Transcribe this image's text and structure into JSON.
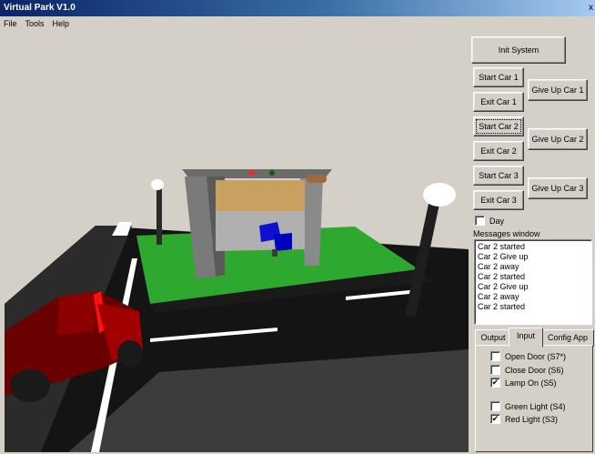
{
  "window": {
    "title": "Virtual Park V1.0",
    "close_label": "x"
  },
  "menu": [
    "File",
    "Tools",
    "Help"
  ],
  "buttons": {
    "init": "Init System",
    "start_car_1": "Start Car 1",
    "exit_car_1": "Exit Car 1",
    "give_up_car_1": "Give Up Car 1",
    "start_car_2": "Start Car 2",
    "exit_car_2": "Exit Car 2",
    "give_up_car_2": "Give Up Car 2",
    "start_car_3": "Start Car 3",
    "exit_car_3": "Exit Car 3",
    "give_up_car_3": "Give Up Car 3"
  },
  "day": {
    "label": "Day",
    "checked": false
  },
  "messages": {
    "label": "Messages window",
    "lines": [
      "Car 2 started",
      "Car 2 Give up",
      "Car 2 away",
      "Car 2 started",
      "Car 2 Give up",
      "Car 2 away",
      "Car 2 started"
    ]
  },
  "tabs": {
    "labels": [
      "Output",
      "Input",
      "Config App"
    ],
    "active": "Input"
  },
  "inputs": [
    {
      "label": "Open Door (S7*)",
      "checked": false
    },
    {
      "label": "Close Door (S6)",
      "checked": false
    },
    {
      "label": "Lamp On (S5)",
      "checked": true
    },
    {
      "label": "Green Light (S4)",
      "checked": false
    },
    {
      "label": "Red Light (S3)",
      "checked": true
    }
  ],
  "colors": {
    "title_start": "#0a246a",
    "window_bg": "#d4d0c8",
    "grass": "#2fa82f",
    "car": "#8b0000"
  }
}
